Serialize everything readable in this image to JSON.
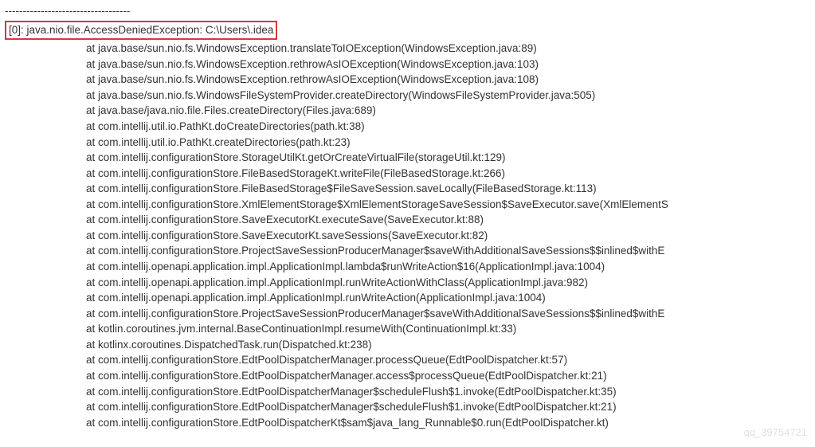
{
  "divider": "-----------------------------------",
  "exception_line": "[0]: java.nio.file.AccessDeniedException: C:\\Users\\.idea",
  "stack_lines": [
    "at java.base/sun.nio.fs.WindowsException.translateToIOException(WindowsException.java:89)",
    "at java.base/sun.nio.fs.WindowsException.rethrowAsIOException(WindowsException.java:103)",
    "at java.base/sun.nio.fs.WindowsException.rethrowAsIOException(WindowsException.java:108)",
    "at java.base/sun.nio.fs.WindowsFileSystemProvider.createDirectory(WindowsFileSystemProvider.java:505)",
    "at java.base/java.nio.file.Files.createDirectory(Files.java:689)",
    "at com.intellij.util.io.PathKt.doCreateDirectories(path.kt:38)",
    "at com.intellij.util.io.PathKt.createDirectories(path.kt:23)",
    "at com.intellij.configurationStore.StorageUtilKt.getOrCreateVirtualFile(storageUtil.kt:129)",
    "at com.intellij.configurationStore.FileBasedStorageKt.writeFile(FileBasedStorage.kt:266)",
    "at com.intellij.configurationStore.FileBasedStorage$FileSaveSession.saveLocally(FileBasedStorage.kt:113)",
    "at com.intellij.configurationStore.XmlElementStorage$XmlElementStorageSaveSession$SaveExecutor.save(XmlElementS",
    "at com.intellij.configurationStore.SaveExecutorKt.executeSave(SaveExecutor.kt:88)",
    "at com.intellij.configurationStore.SaveExecutorKt.saveSessions(SaveExecutor.kt:82)",
    "at com.intellij.configurationStore.ProjectSaveSessionProducerManager$saveWithAdditionalSaveSessions$$inlined$withE",
    "at com.intellij.openapi.application.impl.ApplicationImpl.lambda$runWriteAction$16(ApplicationImpl.java:1004)",
    "at com.intellij.openapi.application.impl.ApplicationImpl.runWriteActionWithClass(ApplicationImpl.java:982)",
    "at com.intellij.openapi.application.impl.ApplicationImpl.runWriteAction(ApplicationImpl.java:1004)",
    "at com.intellij.configurationStore.ProjectSaveSessionProducerManager$saveWithAdditionalSaveSessions$$inlined$withE",
    "at kotlin.coroutines.jvm.internal.BaseContinuationImpl.resumeWith(ContinuationImpl.kt:33)",
    "at kotlinx.coroutines.DispatchedTask.run(Dispatched.kt:238)",
    "at com.intellij.configurationStore.EdtPoolDispatcherManager.processQueue(EdtPoolDispatcher.kt:57)",
    "at com.intellij.configurationStore.EdtPoolDispatcherManager.access$processQueue(EdtPoolDispatcher.kt:21)",
    "at com.intellij.configurationStore.EdtPoolDispatcherManager$scheduleFlush$1.invoke(EdtPoolDispatcher.kt:35)",
    "at com.intellij.configurationStore.EdtPoolDispatcherManager$scheduleFlush$1.invoke(EdtPoolDispatcher.kt:21)",
    "at com.intellij.configurationStore.EdtPoolDispatcherKt$sam$java_lang_Runnable$0.run(EdtPoolDispatcher.kt)"
  ],
  "watermark": "qq_39754721"
}
